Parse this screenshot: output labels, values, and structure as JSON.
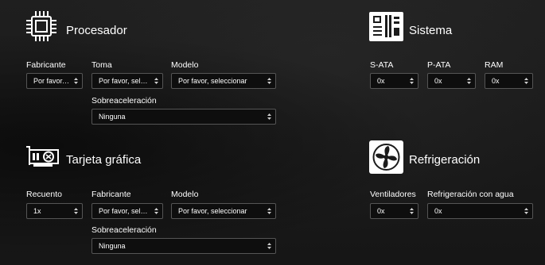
{
  "processor": {
    "title": "Procesador",
    "icon": "cpu-icon",
    "fields": {
      "manufacturer": {
        "label": "Fabricante",
        "value": "Por favor, seleccionar"
      },
      "socket": {
        "label": "Toma",
        "value": "Por favor, seleccionar"
      },
      "model": {
        "label": "Modelo",
        "value": "Por favor, seleccionar"
      },
      "overclock": {
        "label": "Sobreaceleración",
        "value": "Ninguna"
      }
    }
  },
  "system": {
    "title": "Sistema",
    "icon": "motherboard-icon",
    "fields": {
      "sata": {
        "label": "S-ATA",
        "value": "0x"
      },
      "pata": {
        "label": "P-ATA",
        "value": "0x"
      },
      "ram": {
        "label": "RAM",
        "value": "0x"
      }
    }
  },
  "gpu": {
    "title": "Tarjeta gráfica",
    "icon": "graphics-card-icon",
    "fields": {
      "count": {
        "label": "Recuento",
        "value": "1x"
      },
      "manufacturer": {
        "label": "Fabricante",
        "value": "Por favor, seleccionar"
      },
      "model": {
        "label": "Modelo",
        "value": "Por favor, seleccionar"
      },
      "overclock": {
        "label": "Sobreaceleración",
        "value": "Ninguna"
      }
    }
  },
  "cooling": {
    "title": "Refrigeración",
    "icon": "fan-icon",
    "fields": {
      "fans": {
        "label": "Ventiladores",
        "value": "0x"
      },
      "water": {
        "label": "Refrigeración con agua",
        "value": "0x"
      }
    }
  }
}
